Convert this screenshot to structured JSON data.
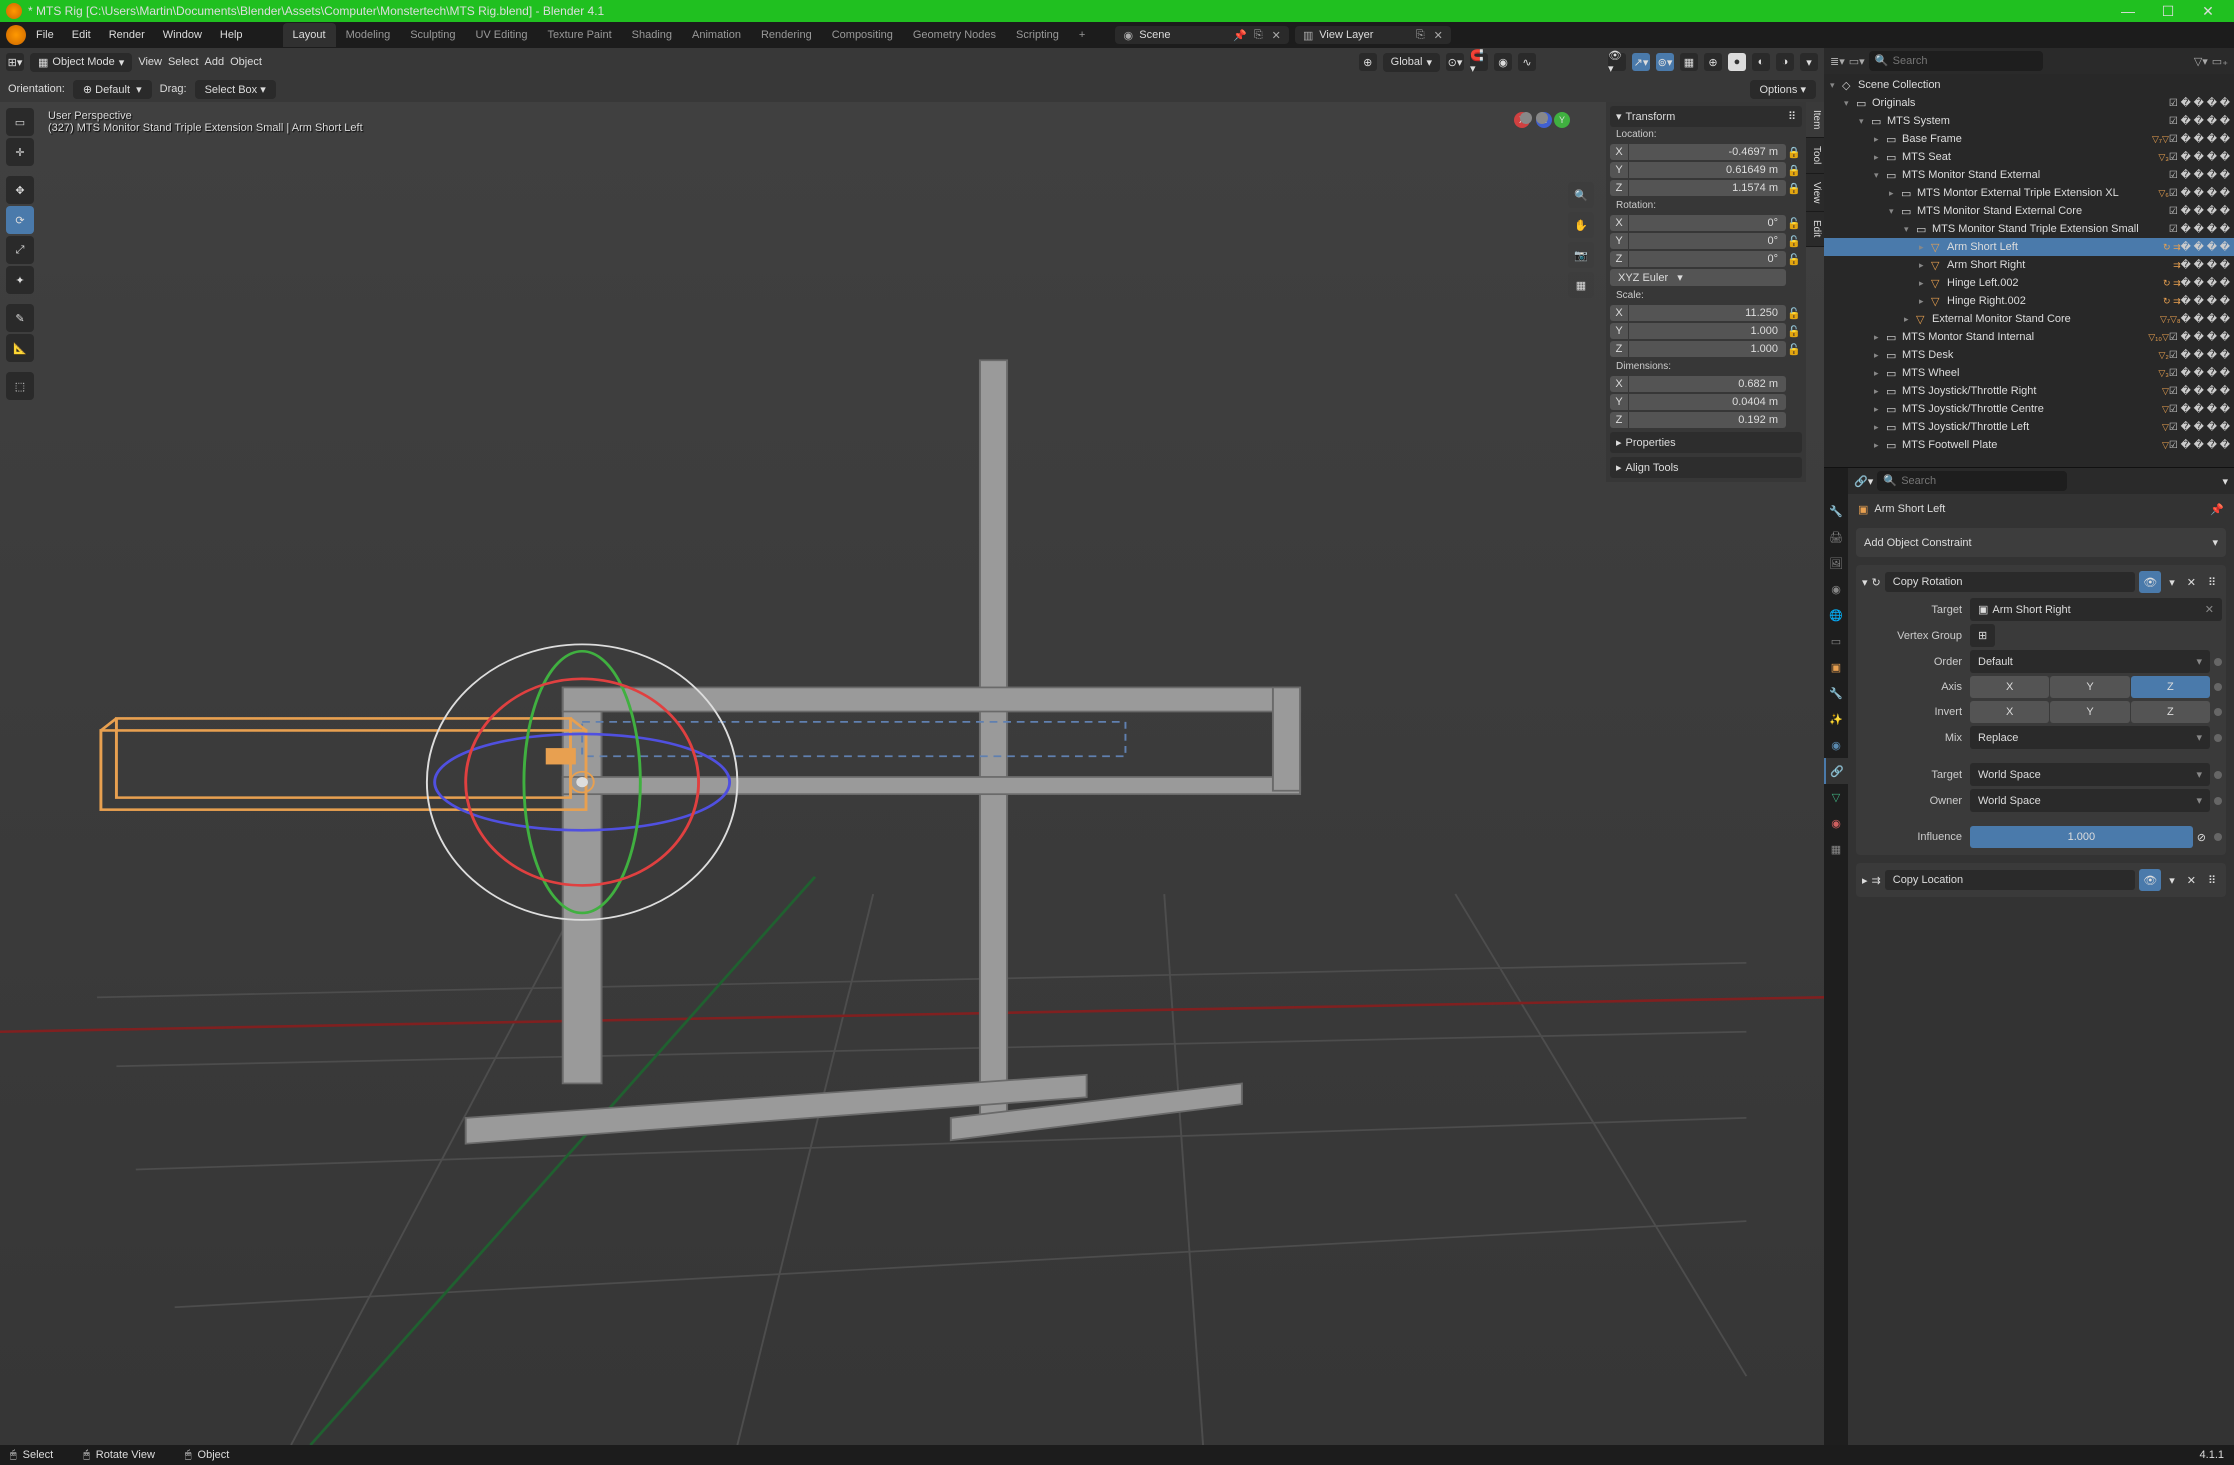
{
  "title": "* MTS Rig [C:\\Users\\Martin\\Documents\\Blender\\Assets\\Computer\\Monstertech\\MTS Rig.blend] - Blender 4.1",
  "menus": [
    "File",
    "Edit",
    "Render",
    "Window",
    "Help"
  ],
  "tabs": [
    "Layout",
    "Modeling",
    "Sculpting",
    "UV Editing",
    "Texture Paint",
    "Shading",
    "Animation",
    "Rendering",
    "Compositing",
    "Geometry Nodes",
    "Scripting"
  ],
  "scene": {
    "label": "Scene",
    "vlayer": "View Layer"
  },
  "vheader": {
    "mode": "Object Mode",
    "view": "View",
    "select": "Select",
    "add": "Add",
    "object": "Object",
    "orient": "Global",
    "options": "Options ▾"
  },
  "vheader2": {
    "orientation": "Orientation:",
    "orient_val": "Default",
    "drag": "Drag:",
    "drag_val": "Select Box ▾"
  },
  "vpinfo": {
    "persp": "User Perspective",
    "sel": "(327) MTS Monitor Stand Triple Extension Small | Arm Short Left"
  },
  "sidetabs": [
    "Item",
    "Tool",
    "View",
    "Edit"
  ],
  "transform": {
    "header": "Transform",
    "loc": "Location:",
    "rot": "Rotation:",
    "scale": "Scale:",
    "dim": "Dimensions:",
    "lx": "-0.4697 m",
    "ly": "0.61649 m",
    "lz": "1.1574 m",
    "rx": "0°",
    "ry": "0°",
    "rz": "0°",
    "rotmode": "XYZ Euler",
    "sx": "11.250",
    "sy": "1.000",
    "sz": "1.000",
    "dx": "0.682 m",
    "dy": "0.0404 m",
    "dz": "0.192 m"
  },
  "npanel_extra": [
    "Properties",
    "Align Tools"
  ],
  "outliner": {
    "search": "Search",
    "tree": [
      {
        "lv": 0,
        "disc": "▾",
        "ico": "◇",
        "nm": "Scene Collection",
        "tg": ""
      },
      {
        "lv": 1,
        "disc": "▾",
        "ico": "▭",
        "nm": "Originals",
        "tg": "☑👁📷",
        "cls": "coll"
      },
      {
        "lv": 2,
        "disc": "▾",
        "ico": "▭",
        "nm": "MTS System",
        "tg": "☑👁📷",
        "cls": "coll"
      },
      {
        "lv": 3,
        "disc": "▸",
        "ico": "▭",
        "nm": "Base Frame",
        "badge": "▽₇▽",
        "tg": "☑👁📷",
        "cls": "coll"
      },
      {
        "lv": 3,
        "disc": "▸",
        "ico": "▭",
        "nm": "MTS Seat",
        "badge": "▽₃",
        "tg": "☑👁📷",
        "cls": "coll"
      },
      {
        "lv": 3,
        "disc": "▾",
        "ico": "▭",
        "nm": "MTS Monitor Stand External",
        "tg": "☑👁📷",
        "cls": "coll"
      },
      {
        "lv": 4,
        "disc": "▸",
        "ico": "▭",
        "nm": "MTS Montor External Triple Extension XL",
        "badge": "▽₆",
        "tg": "☑👁📷",
        "cls": "coll"
      },
      {
        "lv": 4,
        "disc": "▾",
        "ico": "▭",
        "nm": "MTS Monitor Stand External Core",
        "tg": "☑👁📷",
        "cls": "coll"
      },
      {
        "lv": 5,
        "disc": "▾",
        "ico": "▭",
        "nm": "MTS Monitor Stand Triple Extension Small",
        "tg": "☑👁📷",
        "cls": "coll"
      },
      {
        "lv": 6,
        "disc": "▸",
        "ico": "▽",
        "nm": "Arm Short Left",
        "badge": "↻ ⇉",
        "tg": "👁📷",
        "cls": "mesh",
        "sel": true
      },
      {
        "lv": 6,
        "disc": "▸",
        "ico": "▽",
        "nm": "Arm Short Right",
        "badge": "⇉",
        "tg": "👁📷",
        "cls": "mesh"
      },
      {
        "lv": 6,
        "disc": "▸",
        "ico": "▽",
        "nm": "Hinge Left.002",
        "badge": "↻ ⇉",
        "tg": "👁📷",
        "cls": "mesh"
      },
      {
        "lv": 6,
        "disc": "▸",
        "ico": "▽",
        "nm": "Hinge Right.002",
        "badge": "↻ ⇉",
        "tg": "👁📷",
        "cls": "mesh"
      },
      {
        "lv": 5,
        "disc": "▸",
        "ico": "▽",
        "nm": "External Monitor Stand Core",
        "badge": "▽₇▽₈",
        "tg": "👁📷",
        "cls": "mesh"
      },
      {
        "lv": 3,
        "disc": "▸",
        "ico": "▭",
        "nm": "MTS Montor Stand  Internal",
        "badge": "▽₁₀▽",
        "tg": "☑👁📷",
        "cls": "coll"
      },
      {
        "lv": 3,
        "disc": "▸",
        "ico": "▭",
        "nm": "MTS Desk",
        "badge": "▽₂",
        "tg": "☑👁📷",
        "cls": "coll"
      },
      {
        "lv": 3,
        "disc": "▸",
        "ico": "▭",
        "nm": "MTS Wheel",
        "badge": "▽₃",
        "tg": "☑👁📷",
        "cls": "coll"
      },
      {
        "lv": 3,
        "disc": "▸",
        "ico": "▭",
        "nm": "MTS Joystick/Throttle Right",
        "badge": "▽",
        "tg": "☑👁📷",
        "cls": "coll"
      },
      {
        "lv": 3,
        "disc": "▸",
        "ico": "▭",
        "nm": "MTS Joystick/Throttle Centre",
        "badge": "▽",
        "tg": "☑👁📷",
        "cls": "coll"
      },
      {
        "lv": 3,
        "disc": "▸",
        "ico": "▭",
        "nm": "MTS Joystick/Throttle Left",
        "badge": "▽",
        "tg": "☑👁📷",
        "cls": "coll"
      },
      {
        "lv": 3,
        "disc": "▸",
        "ico": "▭",
        "nm": "MTS Footwell Plate",
        "badge": "▽",
        "tg": "☑👁📷",
        "cls": "coll"
      }
    ]
  },
  "props": {
    "search": "Search",
    "objname": "Arm Short Left",
    "addconstraint": "Add Object Constraint",
    "c1": {
      "name": "Copy Rotation",
      "target_lbl": "Target",
      "target": "Arm Short Right",
      "vg_lbl": "Vertex Group",
      "order_lbl": "Order",
      "order": "Default",
      "axis_lbl": "Axis",
      "invert_lbl": "Invert",
      "mix_lbl": "Mix",
      "mix": "Replace",
      "tspace_lbl": "Target",
      "tspace": "World Space",
      "ospace_lbl": "Owner",
      "ospace": "World Space",
      "inf_lbl": "Influence",
      "inf": "1.000"
    },
    "c2": {
      "name": "Copy Location"
    }
  },
  "status": {
    "select": "Select",
    "rotate": "Rotate View",
    "object": "Object",
    "version": "4.1.1"
  }
}
